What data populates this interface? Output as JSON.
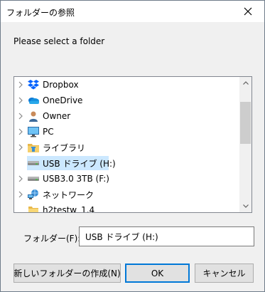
{
  "window": {
    "title": "フォルダーの参照",
    "close_glyph": "✕"
  },
  "instruction": "Please select a folder",
  "tree": {
    "items": [
      {
        "label": "Dropbox",
        "icon": "dropbox-icon",
        "expandable": true,
        "selected": false
      },
      {
        "label": "OneDrive",
        "icon": "onedrive-icon",
        "expandable": true,
        "selected": false
      },
      {
        "label": "Owner",
        "icon": "user-icon",
        "expandable": true,
        "selected": false
      },
      {
        "label": "PC",
        "icon": "computer-icon",
        "expandable": true,
        "selected": false
      },
      {
        "label": "ライブラリ",
        "icon": "library-icon",
        "expandable": true,
        "selected": false
      },
      {
        "label": "USB ドライブ (H:)",
        "icon": "usb-drive-icon",
        "expandable": false,
        "selected": true
      },
      {
        "label": "USB3.0 3TB (F:)",
        "icon": "drive-icon",
        "expandable": true,
        "selected": false
      },
      {
        "label": "ネットワーク",
        "icon": "network-icon",
        "expandable": true,
        "selected": false
      },
      {
        "label": "h2testw_1.4",
        "icon": "folder-icon",
        "expandable": false,
        "selected": false
      }
    ],
    "scrollbar": {
      "up_glyph": "▲",
      "down_glyph": "▼"
    }
  },
  "folder_field": {
    "label": "フォルダー(F):",
    "value": "USB ドライブ (H:)"
  },
  "buttons": {
    "new_folder": "新しいフォルダーの作成(N)",
    "ok": "OK",
    "cancel": "キャンセル"
  },
  "colors": {
    "selection": "#cce8ff",
    "default_button_border": "#0078d7",
    "dialog_background": "#f0f0f0"
  }
}
